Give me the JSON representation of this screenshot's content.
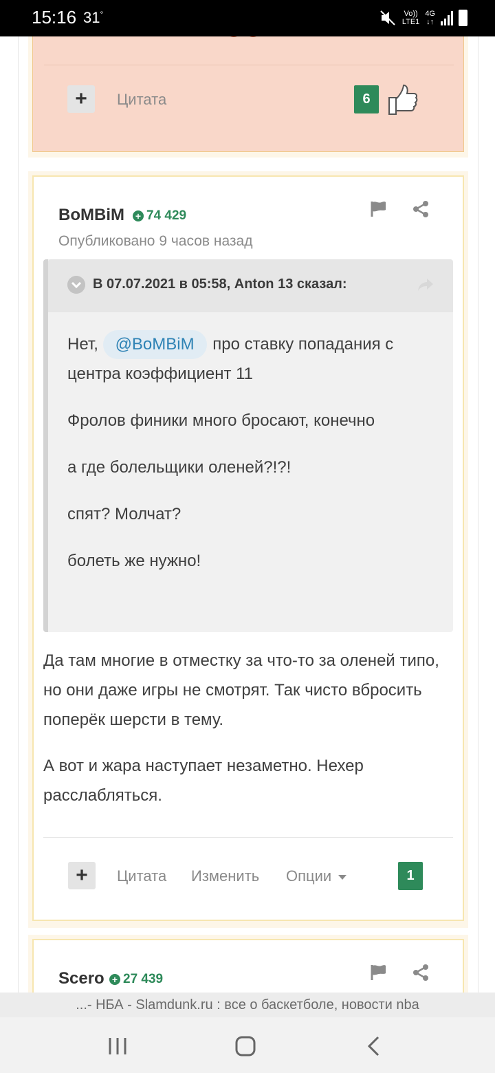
{
  "status": {
    "time": "15:16",
    "temp": "31",
    "net_top": "Vo))",
    "net_bottom": "LTE1",
    "net_type": "4G"
  },
  "post1": {
    "quote_label": "Цитата",
    "likes": "6"
  },
  "post2": {
    "author": "BoMBiM",
    "reputation": "74 429",
    "published": "Опубликовано 9 часов назад",
    "quote": {
      "title": "В 07.07.2021 в 05:58, Anton 13 сказал:",
      "mention": "@BoMBiM",
      "line1_after": "про ставку попадания с центра коэффициент 11",
      "line1_before": "Нет,",
      "line2": "Фролов финики много бросают, конечно",
      "line3": "а где болельщики оленей?!?!",
      "line4": "спят? Молчат?",
      "line5": "болеть же нужно!"
    },
    "body": {
      "p1": "Да там многие в отместку за что-то за оленей типо, но они даже игры не смотрят. Так чисто вбросить поперёк шерсти в тему.",
      "p2": "А вот и жара наступает незаметно. Нехер расслабляться."
    },
    "actions": {
      "quote": "Цитата",
      "edit": "Изменить",
      "options": "Опции"
    },
    "likes": "1"
  },
  "post3": {
    "author": "Scero",
    "reputation": "27 439"
  },
  "urlbar": {
    "text": "...- НБА - Slamdunk.ru : все о баскетболе, новости nba"
  },
  "icons": [
    "mute-icon",
    "signal-icon",
    "battery-icon",
    "plus-icon",
    "thumbs-up-icon",
    "flag-icon",
    "share-icon",
    "chevron-down-icon",
    "forward-icon",
    "caret-down-icon",
    "recents-icon",
    "home-icon",
    "back-icon"
  ],
  "colors": {
    "accent_green": "#2e8a5a",
    "highlight_post": "#f9d7c9",
    "mention_bg": "#e1ecf4",
    "mention_text": "#2f83b5"
  }
}
